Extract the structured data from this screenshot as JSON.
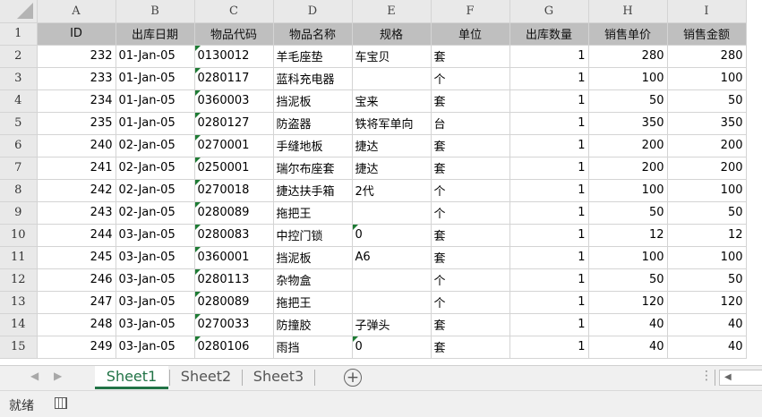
{
  "columns": [
    "A",
    "B",
    "C",
    "D",
    "E",
    "F",
    "G",
    "H",
    "I"
  ],
  "rows": [
    {
      "n": "1",
      "cells": [
        "ID",
        "出库日期",
        "物品代码",
        "物品名称",
        "规格",
        "单位",
        "出库数量",
        "销售单价",
        "销售金额"
      ]
    },
    {
      "n": "2",
      "cells": [
        "232",
        "01-Jan-05",
        "0130012",
        "羊毛座垫",
        "车宝贝",
        "套",
        "1",
        "280",
        "280"
      ]
    },
    {
      "n": "3",
      "cells": [
        "233",
        "01-Jan-05",
        "0280117",
        "蓝科充电器",
        "",
        "个",
        "1",
        "100",
        "100"
      ]
    },
    {
      "n": "4",
      "cells": [
        "234",
        "01-Jan-05",
        "0360003",
        "挡泥板",
        "宝来",
        "套",
        "1",
        "50",
        "50"
      ]
    },
    {
      "n": "5",
      "cells": [
        "235",
        "01-Jan-05",
        "0280127",
        "防盗器",
        "铁将军单向",
        "台",
        "1",
        "350",
        "350"
      ]
    },
    {
      "n": "6",
      "cells": [
        "240",
        "02-Jan-05",
        "0270001",
        "手缝地板",
        "捷达",
        "套",
        "1",
        "200",
        "200"
      ]
    },
    {
      "n": "7",
      "cells": [
        "241",
        "02-Jan-05",
        "0250001",
        "瑞尔布座套",
        "捷达",
        "套",
        "1",
        "200",
        "200"
      ]
    },
    {
      "n": "8",
      "cells": [
        "242",
        "02-Jan-05",
        "0270018",
        "捷达扶手箱",
        "2代",
        "个",
        "1",
        "100",
        "100"
      ]
    },
    {
      "n": "9",
      "cells": [
        "243",
        "02-Jan-05",
        "0280089",
        "拖把王",
        "",
        "个",
        "1",
        "50",
        "50"
      ]
    },
    {
      "n": "10",
      "cells": [
        "244",
        "03-Jan-05",
        "0280083",
        "中控门锁",
        "0",
        "套",
        "1",
        "12",
        "12"
      ]
    },
    {
      "n": "11",
      "cells": [
        "245",
        "03-Jan-05",
        "0360001",
        "挡泥板",
        "A6",
        "套",
        "1",
        "100",
        "100"
      ]
    },
    {
      "n": "12",
      "cells": [
        "246",
        "03-Jan-05",
        "0280113",
        "杂物盒",
        "",
        "个",
        "1",
        "50",
        "50"
      ]
    },
    {
      "n": "13",
      "cells": [
        "247",
        "03-Jan-05",
        "0280089",
        "拖把王",
        "",
        "个",
        "1",
        "120",
        "120"
      ]
    },
    {
      "n": "14",
      "cells": [
        "248",
        "03-Jan-05",
        "0270033",
        "防撞胶",
        "子弹头",
        "套",
        "1",
        "40",
        "40"
      ]
    },
    {
      "n": "15",
      "cells": [
        "249",
        "03-Jan-05",
        "0280106",
        "雨挡",
        "0",
        "套",
        "1",
        "40",
        "40"
      ]
    }
  ],
  "tabs": [
    "Sheet1",
    "Sheet2",
    "Sheet3"
  ],
  "active_tab": "Sheet1",
  "status": {
    "ready": "就绪"
  },
  "colors": {
    "accent": "#217346",
    "header_bg": "#e9e9e9",
    "first_row_bg": "#bfbfbf"
  }
}
